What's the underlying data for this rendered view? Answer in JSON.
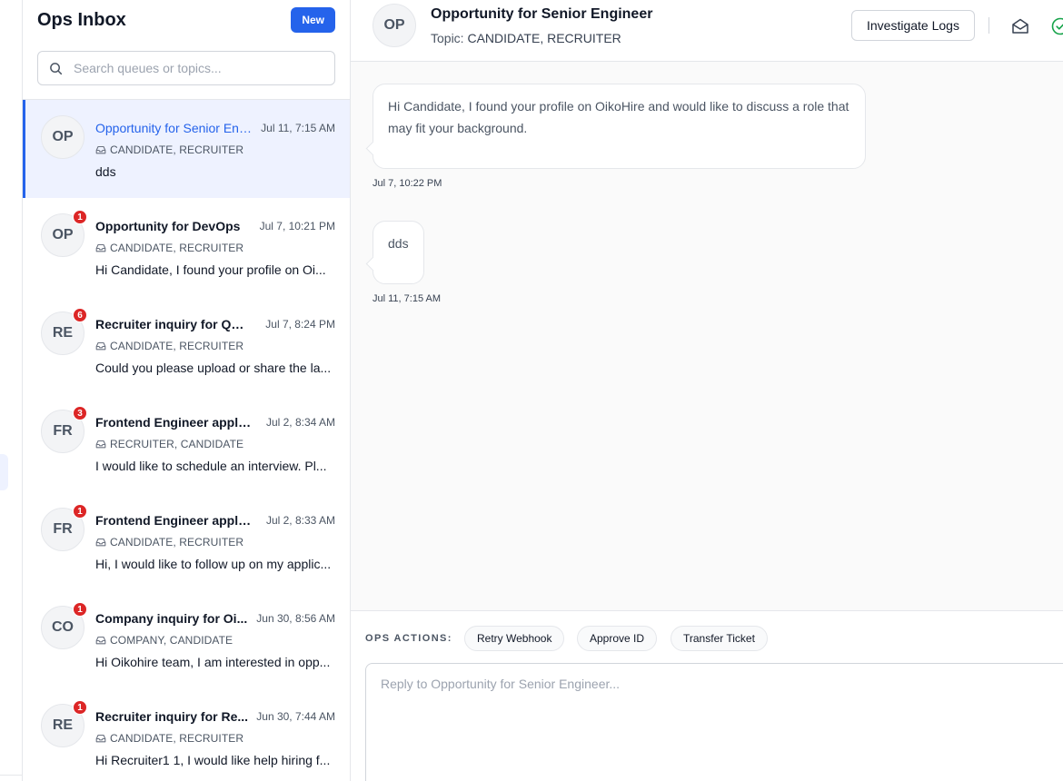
{
  "sidebar": {
    "title": "Ops Inbox",
    "new_label": "New",
    "search_placeholder": "Search queues or topics...",
    "threads": [
      {
        "initials": "OP",
        "badge": "",
        "subject": "Opportunity for Senior Eng...",
        "time": "Jul 11, 7:15 AM",
        "topic": "CANDIDATE, RECRUITER",
        "preview": "dds"
      },
      {
        "initials": "OP",
        "badge": "1",
        "subject": "Opportunity for DevOps",
        "time": "Jul 7, 10:21 PM",
        "topic": "CANDIDATE, RECRUITER",
        "preview": "Hi Candidate, I found your profile on Oi..."
      },
      {
        "initials": "RE",
        "badge": "6",
        "subject": "Recruiter inquiry for QA R...",
        "time": "Jul 7, 8:24 PM",
        "topic": "CANDIDATE, RECRUITER",
        "preview": "Could you please upload or share the la..."
      },
      {
        "initials": "FR",
        "badge": "3",
        "subject": "Frontend Engineer applic...",
        "time": "Jul 2, 8:34 AM",
        "topic": "RECRUITER, CANDIDATE",
        "preview": "I would like to schedule an interview. Pl..."
      },
      {
        "initials": "FR",
        "badge": "1",
        "subject": "Frontend Engineer applic...",
        "time": "Jul 2, 8:33 AM",
        "topic": "CANDIDATE, RECRUITER",
        "preview": "Hi, I would like to follow up on my applic..."
      },
      {
        "initials": "CO",
        "badge": "1",
        "subject": "Company inquiry for Oi...",
        "time": "Jun 30, 8:56 AM",
        "topic": "COMPANY, CANDIDATE",
        "preview": "Hi Oikohire team, I am interested in opp..."
      },
      {
        "initials": "RE",
        "badge": "1",
        "subject": "Recruiter inquiry for Re...",
        "time": "Jun 30, 7:44 AM",
        "topic": "CANDIDATE, RECRUITER",
        "preview": "Hi Recruiter1 1, I would like help hiring f..."
      }
    ]
  },
  "conversation": {
    "initials": "OP",
    "title": "Opportunity for Senior Engineer",
    "topic_label": "Topic:",
    "topic_value": "CANDIDATE, RECRUITER",
    "investigate_label": "Investigate Logs",
    "messages": [
      {
        "text": "Hi Candidate, I found your profile on OikoHire and would like to discuss a role that may fit your background.",
        "time": "Jul 7, 10:22 PM"
      },
      {
        "text": "dds",
        "time": "Jul 11, 7:15 AM"
      }
    ]
  },
  "composer": {
    "ops_label": "OPS ACTIONS:",
    "ops_buttons": [
      "Retry Webhook",
      "Approve ID",
      "Transfer Ticket"
    ],
    "reply_placeholder": "Reply to Opportunity for Senior Engineer..."
  },
  "colors": {
    "accent": "#2563eb",
    "badge": "#dc2626",
    "active_row": "#eef2ff",
    "status_ok": "#16a34a"
  },
  "icons": [
    "search-icon",
    "inbox-tray-icon",
    "envelope-open-icon",
    "check-circle-icon"
  ]
}
